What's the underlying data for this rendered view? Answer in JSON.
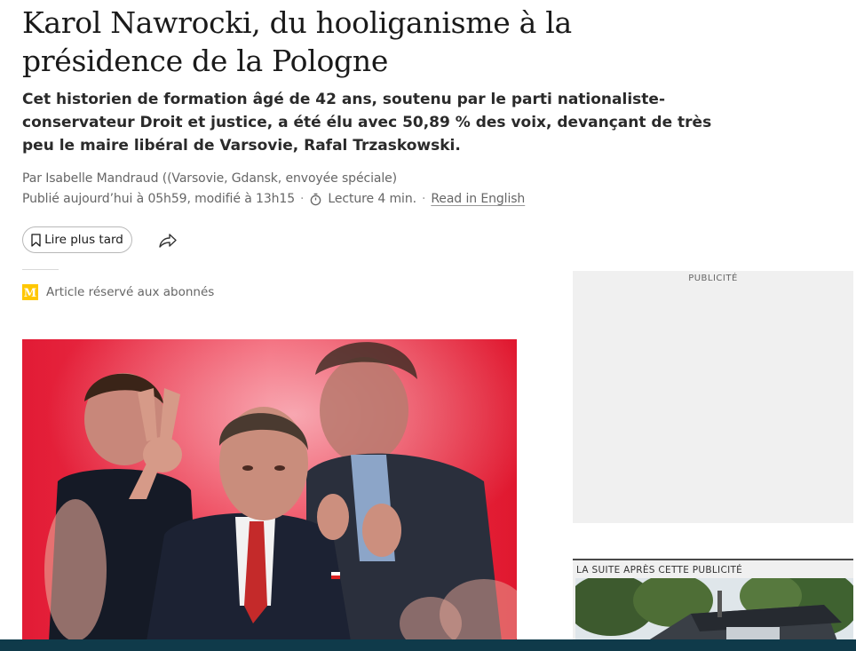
{
  "article": {
    "headline": "Karol Nawrocki, du hooliganisme à la présidence de la Pologne",
    "standfirst": "Cet historien de formation âgé de 42 ans, soutenu par le parti nationaliste-conservateur Droit et justice, a été élu avec 50,89 % des voix, devançant de très peu le maire libéral de Varsovie, Rafal Trzaskowski.",
    "byline": "Par Isabelle Mandraud ((Varsovie, Gdansk, envoyée spéciale)",
    "published": "Publié aujourd’hui à 05h59, modifié à 13h15",
    "separator": "·",
    "reading_time": "Lecture 4 min.",
    "read_in_english": "Read in English",
    "subscriber_note": "Article réservé aux abonnés"
  },
  "actions": {
    "save_label": "Lire plus tard",
    "save_icon": "bookmark-icon",
    "share_icon": "share-icon"
  },
  "ads": {
    "top_label": "PUBLICITÉ",
    "bottom_label": "LA SUITE APRÈS CETTE PUBLICITÉ"
  },
  "colors": {
    "subscriber_badge": "#ffc700",
    "hero_background": "#e51f33",
    "footer_bar": "#0f3a4a",
    "ad_background": "#f0f0f0"
  }
}
